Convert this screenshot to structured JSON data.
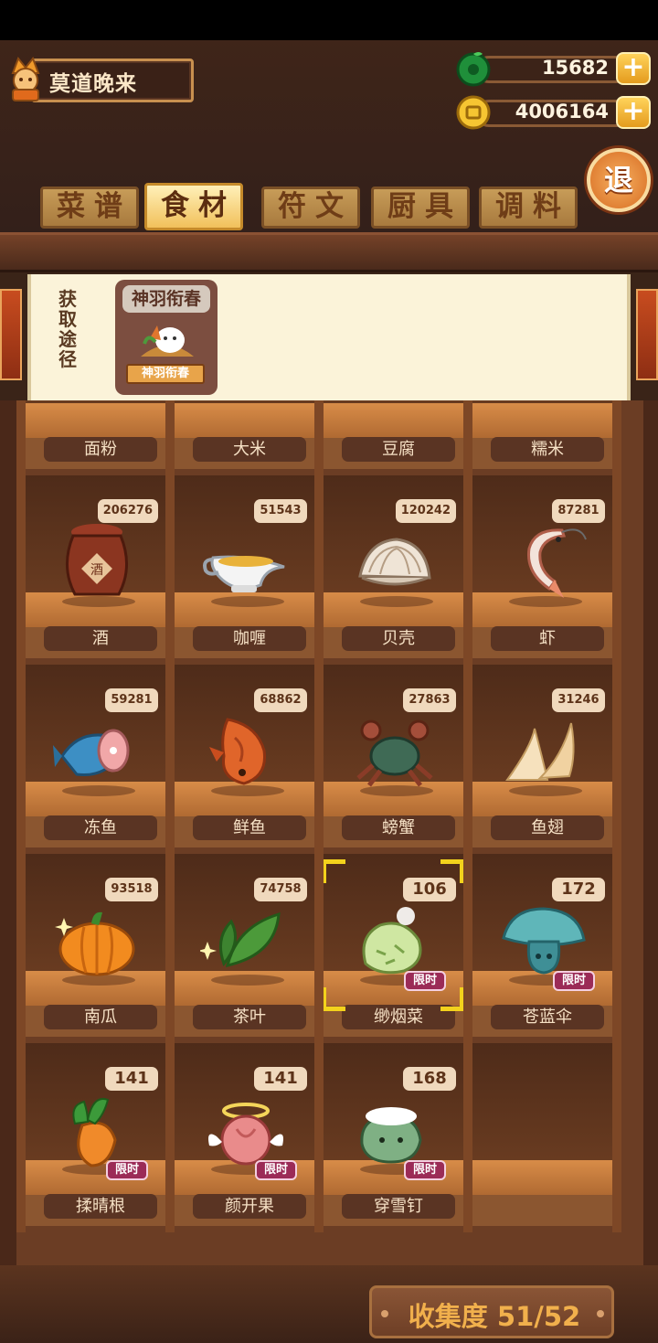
{
  "player": {
    "name": "莫道晚来",
    "avatar_icon": "chef-avatar-icon"
  },
  "currencies": [
    {
      "icon": "jade-icon",
      "value": "15682",
      "plus": "+"
    },
    {
      "icon": "coin-icon",
      "value": "4006164",
      "plus": "+"
    }
  ],
  "exit_label": "退",
  "tabs": [
    {
      "label": "菜谱",
      "active": false
    },
    {
      "label": "食材",
      "active": true
    },
    {
      "label": "符文",
      "active": false
    },
    {
      "label": "厨具",
      "active": false
    },
    {
      "label": "调料",
      "active": false
    }
  ],
  "acquisition": {
    "label": "获取途径",
    "source_title": "神羽衔春",
    "source_badge": "神羽衔春"
  },
  "ingredients": [
    {
      "name": "面粉",
      "count": ""
    },
    {
      "name": "大米",
      "count": ""
    },
    {
      "name": "豆腐",
      "count": ""
    },
    {
      "name": "糯米",
      "count": ""
    },
    {
      "name": "酒",
      "count": "206276",
      "icon": "wine-jar-icon"
    },
    {
      "name": "咖喱",
      "count": "51543",
      "icon": "curry-gravy-boat-icon"
    },
    {
      "name": "贝壳",
      "count": "120242",
      "icon": "clam-shell-icon"
    },
    {
      "name": "虾",
      "count": "87281",
      "icon": "shrimp-icon"
    },
    {
      "name": "冻鱼",
      "count": "59281",
      "icon": "frozen-fish-icon"
    },
    {
      "name": "鲜鱼",
      "count": "68862",
      "icon": "fresh-fish-icon"
    },
    {
      "name": "螃蟹",
      "count": "27863",
      "icon": "crab-icon"
    },
    {
      "name": "鱼翅",
      "count": "31246",
      "icon": "shark-fin-icon"
    },
    {
      "name": "南瓜",
      "count": "93518",
      "icon": "pumpkin-icon"
    },
    {
      "name": "茶叶",
      "count": "74758",
      "icon": "tea-leaves-icon"
    },
    {
      "name": "缈烟菜",
      "count": "106",
      "limited": "限时",
      "icon": "cabbage-icon",
      "selected": true
    },
    {
      "name": "苍蓝伞",
      "count": "172",
      "limited": "限时",
      "icon": "blue-mushroom-icon"
    },
    {
      "name": "揉晴根",
      "count": "141",
      "limited": "限时",
      "icon": "carrot-icon"
    },
    {
      "name": "颜开果",
      "count": "141",
      "limited": "限时",
      "icon": "pink-fruit-icon"
    },
    {
      "name": "穿雪钉",
      "count": "168",
      "limited": "限时",
      "icon": "snow-creature-icon"
    }
  ],
  "collection": {
    "label": "收集度 51/52"
  }
}
